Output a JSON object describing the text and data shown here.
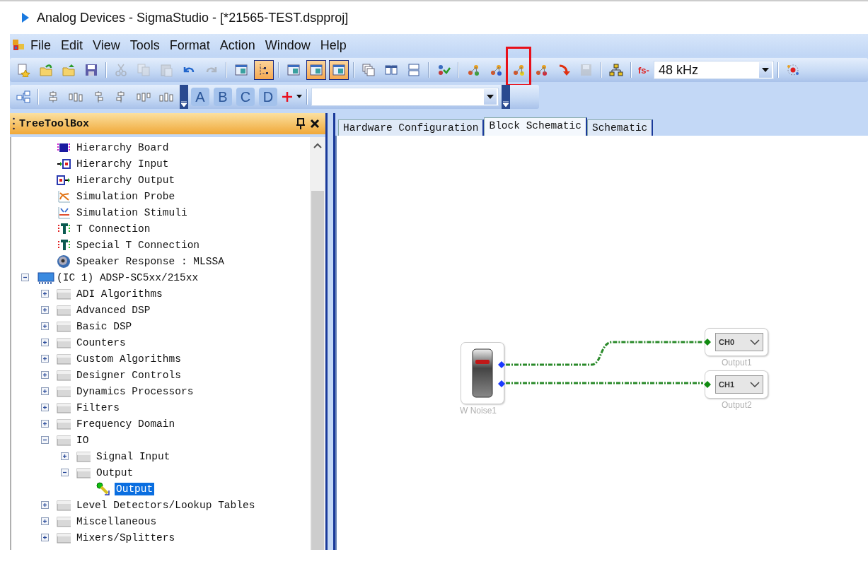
{
  "window": {
    "title": "Analog Devices - SigmaStudio - [*21565-TEST.dspproj]"
  },
  "menu": [
    "File",
    "Edit",
    "View",
    "Tools",
    "Format",
    "Action",
    "Window",
    "Help"
  ],
  "toolbar_main": [
    {
      "kind": "new",
      "checked": false,
      "disabled": false,
      "highlighted": false
    },
    {
      "kind": "open",
      "checked": false,
      "disabled": false,
      "highlighted": false
    },
    {
      "kind": "open-up",
      "checked": false,
      "disabled": false,
      "highlighted": false
    },
    {
      "kind": "save",
      "checked": false,
      "disabled": false,
      "highlighted": false
    },
    {
      "kind": "sep"
    },
    {
      "kind": "cut",
      "checked": false,
      "disabled": true,
      "highlighted": false
    },
    {
      "kind": "copy",
      "checked": false,
      "disabled": true,
      "highlighted": false
    },
    {
      "kind": "paste",
      "checked": false,
      "disabled": true,
      "highlighted": false
    },
    {
      "kind": "undo",
      "checked": false,
      "disabled": false,
      "highlighted": false
    },
    {
      "kind": "redo",
      "checked": false,
      "disabled": true,
      "highlighted": false
    },
    {
      "kind": "sep"
    },
    {
      "kind": "panel",
      "checked": false,
      "disabled": false,
      "highlighted": false
    },
    {
      "kind": "tree",
      "checked": true,
      "disabled": false,
      "highlighted": false
    },
    {
      "kind": "sep"
    },
    {
      "kind": "panel",
      "checked": false,
      "disabled": false,
      "highlighted": false
    },
    {
      "kind": "panel",
      "checked": true,
      "disabled": false,
      "highlighted": false
    },
    {
      "kind": "panel",
      "checked": true,
      "disabled": false,
      "highlighted": false
    },
    {
      "kind": "sep"
    },
    {
      "kind": "stack",
      "checked": false,
      "disabled": false,
      "highlighted": false
    },
    {
      "kind": "columns",
      "checked": false,
      "disabled": false,
      "highlighted": false
    },
    {
      "kind": "rows",
      "checked": false,
      "disabled": false,
      "highlighted": false
    },
    {
      "kind": "sep"
    },
    {
      "kind": "check",
      "checked": false,
      "disabled": false,
      "highlighted": false
    },
    {
      "kind": "sep"
    },
    {
      "kind": "nodes",
      "checked": false,
      "disabled": false,
      "highlighted": false
    },
    {
      "kind": "nodes-blue",
      "checked": false,
      "disabled": false,
      "highlighted": false
    },
    {
      "kind": "nodes-yellow",
      "checked": false,
      "disabled": false,
      "highlighted": true
    },
    {
      "kind": "nodes-red",
      "checked": false,
      "disabled": false,
      "highlighted": false
    },
    {
      "kind": "arrow",
      "checked": false,
      "disabled": false,
      "highlighted": false
    },
    {
      "kind": "disk",
      "checked": false,
      "disabled": true,
      "highlighted": false
    },
    {
      "kind": "sep"
    },
    {
      "kind": "network",
      "checked": false,
      "disabled": false,
      "highlighted": false
    },
    {
      "kind": "sep"
    }
  ],
  "sample_rate": {
    "label": "fs-",
    "value": "48 kHz"
  },
  "toolbar_align": [
    {
      "kind": "hierarchy"
    },
    {
      "kind": "sep"
    },
    {
      "kind": "align-1"
    },
    {
      "kind": "align-2"
    },
    {
      "kind": "align-3"
    },
    {
      "kind": "align-4"
    },
    {
      "kind": "align-5"
    },
    {
      "kind": "align-6"
    }
  ],
  "letter_buttons": [
    {
      "label": "A",
      "disabled": true
    },
    {
      "label": "B",
      "disabled": true
    },
    {
      "label": "C",
      "disabled": true
    },
    {
      "label": "D",
      "disabled": true
    }
  ],
  "panel": {
    "title": "TreeToolBox"
  },
  "tree": {
    "partial_branch": [
      {
        "label": "Hierarchy Board",
        "kind": "board"
      },
      {
        "label": "Hierarchy Input",
        "kind": "hin"
      },
      {
        "label": "Hierarchy Output",
        "kind": "hout"
      },
      {
        "label": "Simulation Probe",
        "kind": "probe"
      },
      {
        "label": "Simulation Stimuli",
        "kind": "stimuli"
      },
      {
        "label": "T Connection",
        "kind": "tconn"
      },
      {
        "label": "Special T Connection",
        "kind": "tconn"
      },
      {
        "label": "Speaker Response : MLSSA",
        "kind": "speaker"
      }
    ],
    "items": [
      {
        "label": "(IC 1) ADSP-SC5xx/215xx",
        "kind": "chip",
        "expanded": true,
        "selected": false,
        "children": [
          {
            "label": "ADI Algorithms",
            "kind": "folder",
            "expanded": false,
            "selected": false
          },
          {
            "label": "Advanced DSP",
            "kind": "folder",
            "expanded": false,
            "selected": false
          },
          {
            "label": "Basic DSP",
            "kind": "folder",
            "expanded": false,
            "selected": false
          },
          {
            "label": "Counters",
            "kind": "folder",
            "expanded": false,
            "selected": false
          },
          {
            "label": "Custom Algorithms",
            "kind": "folder",
            "expanded": false,
            "selected": false
          },
          {
            "label": "Designer Controls",
            "kind": "folder",
            "expanded": false,
            "selected": false
          },
          {
            "label": "Dynamics Processors",
            "kind": "folder",
            "expanded": false,
            "selected": false
          },
          {
            "label": "Filters",
            "kind": "folder",
            "expanded": false,
            "selected": false
          },
          {
            "label": "Frequency Domain",
            "kind": "folder",
            "expanded": false,
            "selected": false
          },
          {
            "label": "IO",
            "kind": "folder",
            "expanded": true,
            "selected": false,
            "children": [
              {
                "label": "Signal Input",
                "kind": "folder",
                "expanded": false,
                "selected": false
              },
              {
                "label": "Output",
                "kind": "folder",
                "expanded": true,
                "selected": false,
                "children": [
                  {
                    "label": "Output",
                    "kind": "pin",
                    "selected": true
                  }
                ]
              }
            ]
          },
          {
            "label": "Level Detectors/Lookup Tables",
            "kind": "folder",
            "expanded": false,
            "selected": false
          },
          {
            "label": "Miscellaneous",
            "kind": "folder",
            "expanded": false,
            "selected": false
          },
          {
            "label": "Mixers/Splitters",
            "kind": "folder",
            "expanded": false,
            "selected": false
          }
        ]
      }
    ]
  },
  "tabs": [
    {
      "label": "Hardware Configuration",
      "selected": false
    },
    {
      "label": "Block Schematic",
      "selected": true
    },
    {
      "label": "Schematic",
      "selected": false
    }
  ],
  "blocks": [
    {
      "kind": "noise",
      "label": "W Noise1"
    },
    {
      "kind": "output",
      "label": "Output1",
      "channel": "CH0"
    },
    {
      "kind": "output",
      "label": "Output2",
      "channel": "CH1"
    }
  ]
}
